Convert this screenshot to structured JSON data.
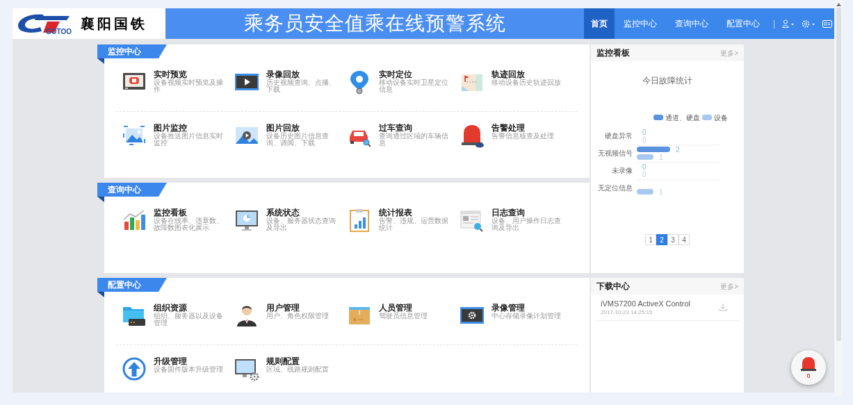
{
  "header": {
    "logo_text": "GOTOO",
    "brand": "襄阳国铁",
    "title": "乘务员安全值乘在线预警系统",
    "nav": [
      {
        "label": "首页",
        "selected": true
      },
      {
        "label": "监控中心",
        "selected": false
      },
      {
        "label": "查询中心",
        "selected": false
      },
      {
        "label": "配置中心",
        "selected": false
      }
    ],
    "separator": "|"
  },
  "sections": [
    {
      "title": "监控中心",
      "items": [
        {
          "title": "实时预览",
          "desc": "设备视频实时预览及操作"
        },
        {
          "title": "录像回放",
          "desc": "历史视频查询、点播、下载"
        },
        {
          "title": "实时定位",
          "desc": "移动设备实时卫星定位信息"
        },
        {
          "title": "轨迹回放",
          "desc": "移动设备历史轨迹回放"
        },
        {
          "title": "图片监控",
          "desc": "设备推送图片信息实时监控"
        },
        {
          "title": "图片回放",
          "desc": "设备历史图片信息查询、调阅、下载"
        },
        {
          "title": "过车查询",
          "desc": "查询通过区域的车辆信息"
        },
        {
          "title": "告警处理",
          "desc": "告警信息核查及处理"
        }
      ]
    },
    {
      "title": "查询中心",
      "items": [
        {
          "title": "监控看板",
          "desc": "设备在线率、违章数、故障数图表化展示"
        },
        {
          "title": "系统状态",
          "desc": "设备、服务器状态查询及导出"
        },
        {
          "title": "统计报表",
          "desc": "告警、违规、运营数据统计"
        },
        {
          "title": "日志查询",
          "desc": "设备、用户操作日志查询及导出"
        }
      ]
    },
    {
      "title": "配置中心",
      "items": [
        {
          "title": "组织资源",
          "desc": "组织、服务器以及设备管理"
        },
        {
          "title": "用户管理",
          "desc": "用户、角色权限管理"
        },
        {
          "title": "人员管理",
          "desc": "驾驶员信息管理"
        },
        {
          "title": "录像管理",
          "desc": "中心存储录像计划管理"
        },
        {
          "title": "升级管理",
          "desc": "设备固件版本升级管理"
        },
        {
          "title": "规则配置",
          "desc": "区域、线路规则配置"
        }
      ]
    }
  ],
  "dashboard": {
    "title": "监控看板",
    "more": "更多>",
    "chart_data": {
      "type": "bar",
      "orientation": "horizontal",
      "title": "今日故障统计",
      "categories": [
        "硬盘异常",
        "无视频信号",
        "未录像",
        "无定位信息"
      ],
      "series": [
        {
          "name": "设备",
          "color": "#a9c8f0",
          "values": [
            0,
            1,
            0,
            1
          ]
        },
        {
          "name": "通道、硬盘",
          "color": "#5b93de",
          "values": [
            0,
            2,
            0,
            null
          ]
        }
      ],
      "data_labels": true,
      "grid": true,
      "legend": "top right"
    },
    "pages": [
      {
        "label": "1",
        "selected": false
      },
      {
        "label": "2",
        "selected": true
      },
      {
        "label": "3",
        "selected": false
      },
      {
        "label": "4",
        "selected": false
      }
    ]
  },
  "downloads": {
    "title": "下载中心",
    "more": "更多>",
    "items": [
      {
        "name": "iVMS7200 ActiveX Control",
        "date": "2017-10-23 14:25:15"
      }
    ]
  },
  "alarm": {
    "count": "0"
  }
}
